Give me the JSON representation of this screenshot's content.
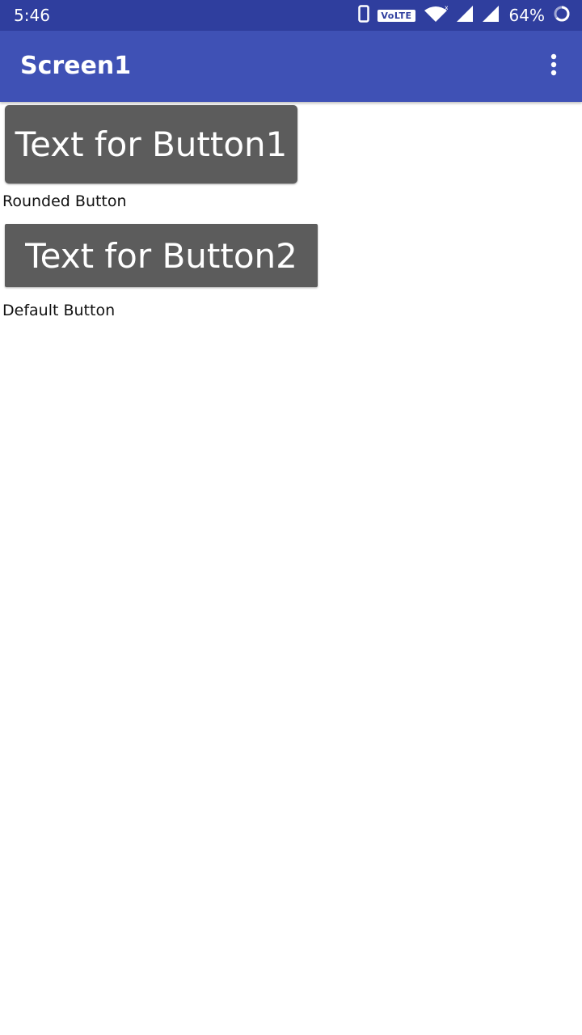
{
  "status_bar": {
    "time": "5:46",
    "volte_label": "VoLTE",
    "battery_percent": "64%",
    "icons": [
      "phone-icon",
      "wifi-icon",
      "signal-icon",
      "signal-icon",
      "battery-icon"
    ]
  },
  "app_bar": {
    "title": "Screen1",
    "menu_icon": "more-vert-icon"
  },
  "main": {
    "button1_label": "Text for Button1",
    "button1_caption": "Rounded Button",
    "button2_label": "Text for Button2",
    "button2_caption": "Default Button"
  },
  "colors": {
    "status_bar": "#2f3e9e",
    "app_bar": "#3f51b5",
    "button": "#5c5c5c"
  }
}
